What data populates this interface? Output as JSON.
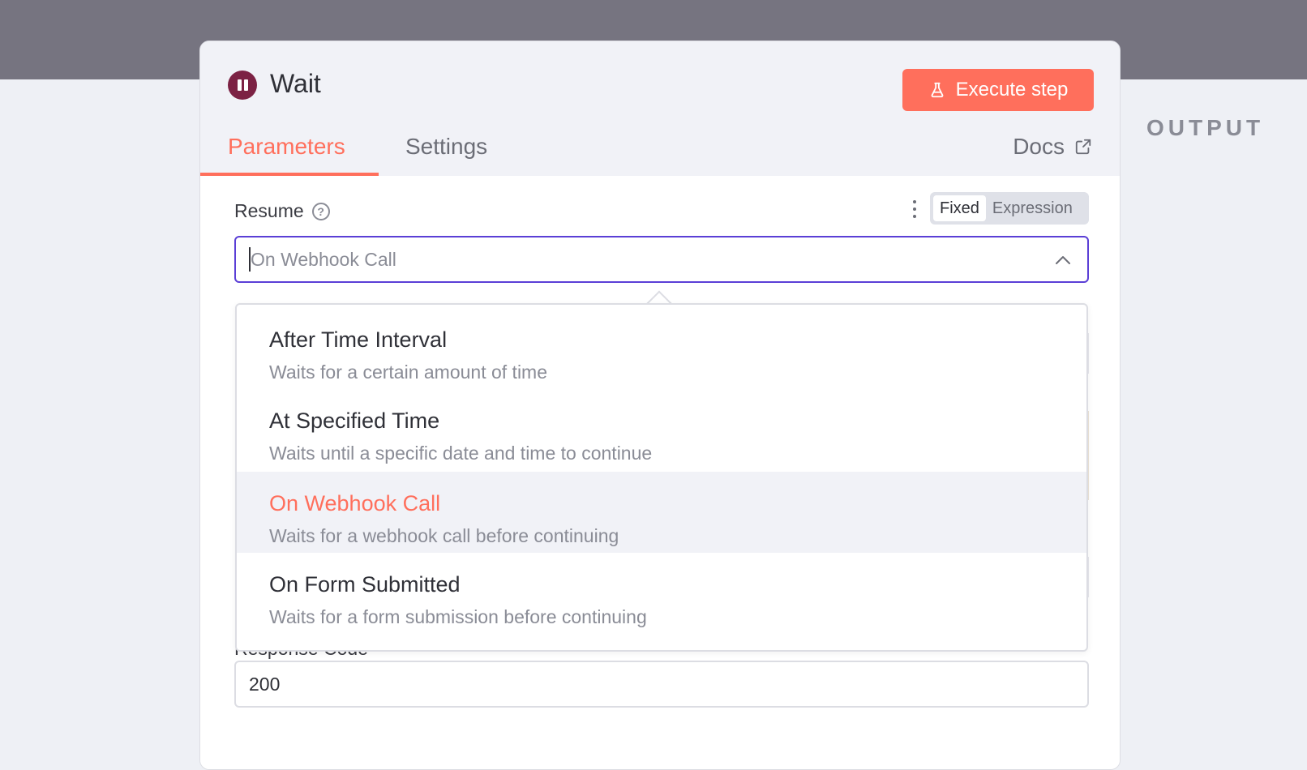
{
  "side_panel": {
    "output_label": "OUTPUT"
  },
  "node": {
    "title": "Wait",
    "execute_label": "Execute step",
    "icon": "pause-icon"
  },
  "tabs": {
    "parameters": "Parameters",
    "settings": "Settings",
    "docs": "Docs",
    "active": "Parameters"
  },
  "resume_field": {
    "label": "Resume",
    "mode_fixed": "Fixed",
    "mode_expression": "Expression",
    "mode_active": "Fixed",
    "placeholder": "On Webhook Call"
  },
  "dropdown": {
    "options": [
      {
        "title": "After Time Interval",
        "description": "Waits for a certain amount of time"
      },
      {
        "title": "At Specified Time",
        "description": "Waits until a specific date and time to continue"
      },
      {
        "title": "On Webhook Call",
        "description": "Waits for a webhook call before continuing"
      },
      {
        "title": "On Form Submitted",
        "description": "Waits for a form submission before continuing"
      }
    ],
    "selected_title": "On Webhook Call"
  },
  "response_code": {
    "label": "Response Code",
    "value": "200"
  },
  "colors": {
    "accent": "#ff6f5c",
    "focus_border": "#5b3fd6",
    "node_icon": "#7c2244",
    "header_backdrop": "#767480"
  }
}
